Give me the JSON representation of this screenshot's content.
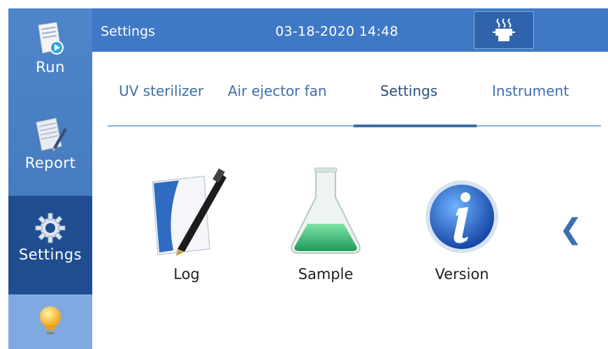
{
  "sidebar": {
    "items": [
      {
        "label": "Run",
        "icon": "run-icon"
      },
      {
        "label": "Report",
        "icon": "report-icon"
      },
      {
        "label": "Settings",
        "icon": "gear-icon",
        "active": true
      },
      {
        "label": "",
        "icon": "lightbulb-icon"
      }
    ]
  },
  "header": {
    "title": "Settings",
    "datetime": "03-18-2020 14:48",
    "printer_icon": "heated-printer-icon"
  },
  "tabs": [
    {
      "label": "UV sterilizer"
    },
    {
      "label": "Air ejector fan"
    },
    {
      "label": "Settings",
      "active": true
    },
    {
      "label": "Instrument"
    }
  ],
  "apps": [
    {
      "label": "Log",
      "icon": "log-pen-icon"
    },
    {
      "label": "Sample",
      "icon": "flask-icon"
    },
    {
      "label": "Version",
      "icon": "info-icon"
    }
  ],
  "nav": {
    "prev_icon": "chevron-left-icon"
  },
  "colors": {
    "sidebar": "#4f85c9",
    "topbar": "#3f79c5",
    "active": "#1f4d8f",
    "accent": "#3a6fa6"
  }
}
